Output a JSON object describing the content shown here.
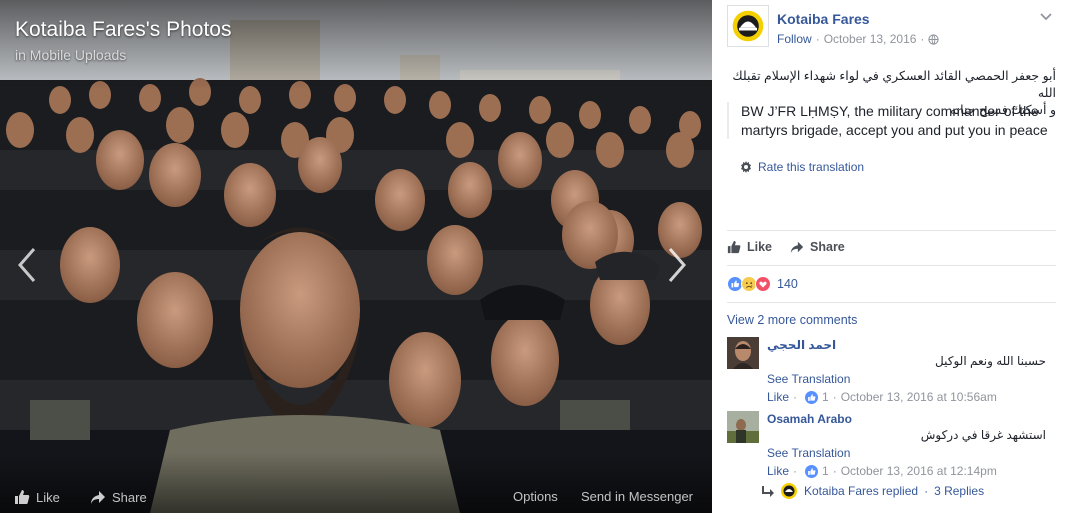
{
  "photo_viewer": {
    "album_title": "Kotaiba Fares's Photos",
    "album_subtitle": "in Mobile Uploads",
    "bottom_actions": {
      "like": "Like",
      "share": "Share",
      "options": "Options",
      "send": "Send in Messenger"
    }
  },
  "post": {
    "author": "Kotaiba Fares",
    "follow": "Follow",
    "date": "October 13, 2016",
    "separator": "·",
    "caption_ar_1": "أبو جعفر الحمصي القائد العسكري في لواء شهداء الإسلام تقبلك الله",
    "caption_ar_2": "و أسكنك فسيح جنانه",
    "translation": "BW J’FR LḤMṢY, the military commander of the martyrs brigade, accept you and put you in peace",
    "rate_translation": "Rate this translation",
    "like_label": "Like",
    "share_label": "Share",
    "reaction_count": "140",
    "reaction_icons": [
      "like-icon",
      "sad-icon",
      "love-icon"
    ],
    "view_more": "View 2 more comments"
  },
  "comments": [
    {
      "name": "احمد الحجي",
      "text": "حسبنا الله ونعم الوكيل",
      "see_translation": "See Translation",
      "like": "Like",
      "dot": "·",
      "likes": "1",
      "time": "October 13, 2016 at 10:56am"
    },
    {
      "name": "Osamah Arabo",
      "text": "استشهد غرقا في دركوش",
      "see_translation": "See Translation",
      "like": "Like",
      "dot": "·",
      "likes": "1",
      "time": "October 13, 2016 at 12:14pm"
    }
  ],
  "replies": {
    "label": "Kotaiba Fares replied",
    "dot": "·",
    "count": "3 Replies"
  },
  "colors": {
    "link": "#365899",
    "brand_yellow": "#f5d000",
    "like_blue": "#5890ff",
    "love_red": "#f25268"
  }
}
